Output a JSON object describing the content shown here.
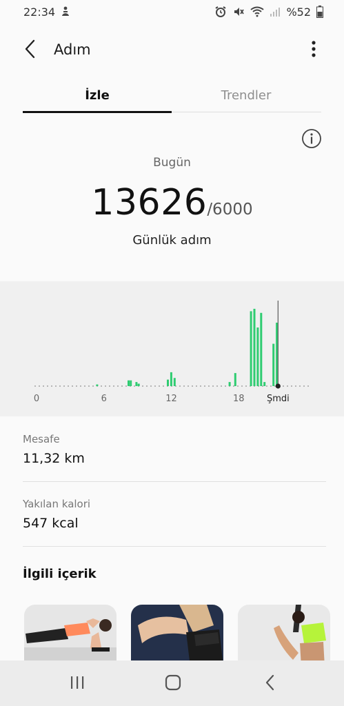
{
  "status_bar": {
    "time": "22:34",
    "battery_text": "%52"
  },
  "header": {
    "title": "Adım"
  },
  "tabs": [
    {
      "label": "İzle"
    },
    {
      "label": "Trendler"
    }
  ],
  "summary": {
    "period_label": "Bugün",
    "steps": "13626",
    "goal": "/6000",
    "unit_label": "Günlük adım"
  },
  "chart_data": {
    "type": "bar",
    "x_tick_labels": [
      "0",
      "6",
      "12",
      "18",
      "Şmdi"
    ],
    "bar_color": "#2ecc71",
    "note": "hourly step bars for today, relative heights (0-1)",
    "bars": [
      {
        "hour": 5.3,
        "v": 0.02
      },
      {
        "hour": 8.1,
        "v": 0.07
      },
      {
        "hour": 8.3,
        "v": 0.07
      },
      {
        "hour": 8.8,
        "v": 0.05
      },
      {
        "hour": 9.0,
        "v": 0.03
      },
      {
        "hour": 11.6,
        "v": 0.08
      },
      {
        "hour": 11.9,
        "v": 0.17
      },
      {
        "hour": 12.2,
        "v": 0.1
      },
      {
        "hour": 17.1,
        "v": 0.05
      },
      {
        "hour": 17.6,
        "v": 0.16
      },
      {
        "hour": 19.0,
        "v": 0.92
      },
      {
        "hour": 19.3,
        "v": 0.95
      },
      {
        "hour": 19.6,
        "v": 0.72
      },
      {
        "hour": 19.9,
        "v": 0.9
      },
      {
        "hour": 20.2,
        "v": 0.05
      },
      {
        "hour": 21.0,
        "v": 0.52
      },
      {
        "hour": 21.3,
        "v": 0.78
      }
    ],
    "now_hour": 21.5
  },
  "stats": [
    {
      "label": "Mesafe",
      "value": "11,32 km"
    },
    {
      "label": "Yakılan kalori",
      "value": "547 kcal"
    }
  ],
  "related": {
    "title": "İlgili içerik"
  },
  "colors": {
    "accent": "#2ecc71",
    "text": "#111111",
    "muted": "#8e8e8e"
  },
  "icons": [
    "back-arrow-icon",
    "more-vert-icon",
    "info-icon",
    "recents-icon",
    "home-icon",
    "nav-back-icon"
  ]
}
